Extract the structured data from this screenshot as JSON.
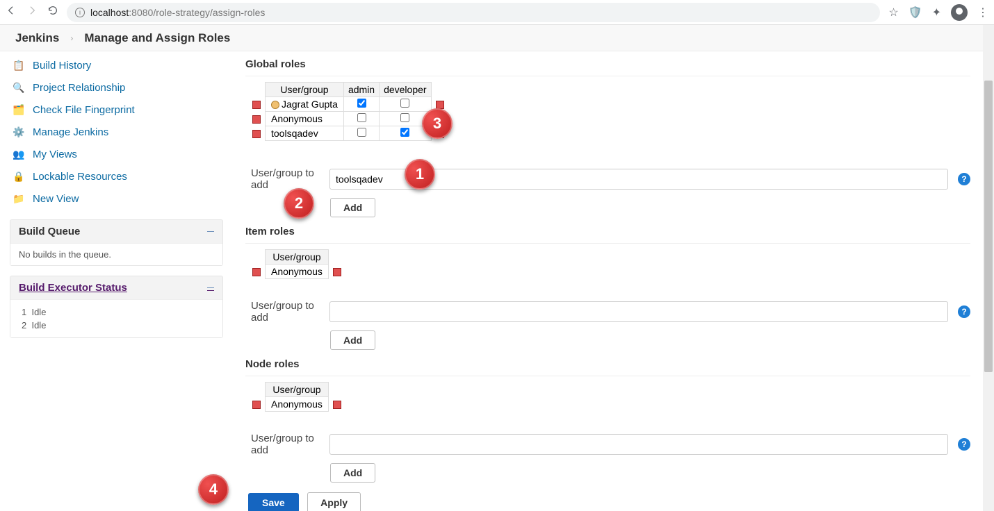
{
  "browser": {
    "url_host": "localhost",
    "url_port": ":8080",
    "url_path": "/role-strategy/assign-roles"
  },
  "breadcrumb": {
    "root": "Jenkins",
    "current": "Manage and Assign Roles"
  },
  "sidebar": {
    "items": [
      {
        "label": "Build History",
        "icon": "📋"
      },
      {
        "label": "Project Relationship",
        "icon": "🔍"
      },
      {
        "label": "Check File Fingerprint",
        "icon": "🗂️"
      },
      {
        "label": "Manage Jenkins",
        "icon": "⚙️"
      },
      {
        "label": "My Views",
        "icon": "👥"
      },
      {
        "label": "Lockable Resources",
        "icon": "🔒"
      },
      {
        "label": "New View",
        "icon": "📁"
      }
    ],
    "build_queue": {
      "title": "Build Queue",
      "empty": "No builds in the queue."
    },
    "executor": {
      "title": "Build Executor Status",
      "rows": [
        {
          "num": "1",
          "state": "Idle"
        },
        {
          "num": "2",
          "state": "Idle"
        }
      ]
    }
  },
  "global": {
    "title": "Global roles",
    "columns": [
      "User/group",
      "admin",
      "developer"
    ],
    "rows": [
      {
        "name": "Jagrat Gupta",
        "admin": true,
        "developer": false,
        "user_icon": true
      },
      {
        "name": "Anonymous",
        "admin": false,
        "developer": false,
        "user_icon": false
      },
      {
        "name": "toolsqadev",
        "admin": false,
        "developer": true,
        "user_icon": false
      }
    ],
    "add_label": "User/group to add",
    "add_value": "toolsqadev",
    "add_btn": "Add"
  },
  "item": {
    "title": "Item roles",
    "columns": [
      "User/group"
    ],
    "rows": [
      {
        "name": "Anonymous"
      }
    ],
    "add_label": "User/group to add",
    "add_value": "",
    "add_btn": "Add"
  },
  "node": {
    "title": "Node roles",
    "columns": [
      "User/group"
    ],
    "rows": [
      {
        "name": "Anonymous"
      }
    ],
    "add_label": "User/group to add",
    "add_value": "",
    "add_btn": "Add"
  },
  "buttons": {
    "save": "Save",
    "apply": "Apply"
  },
  "callouts": {
    "c1": "1",
    "c2": "2",
    "c3": "3",
    "c4": "4"
  }
}
